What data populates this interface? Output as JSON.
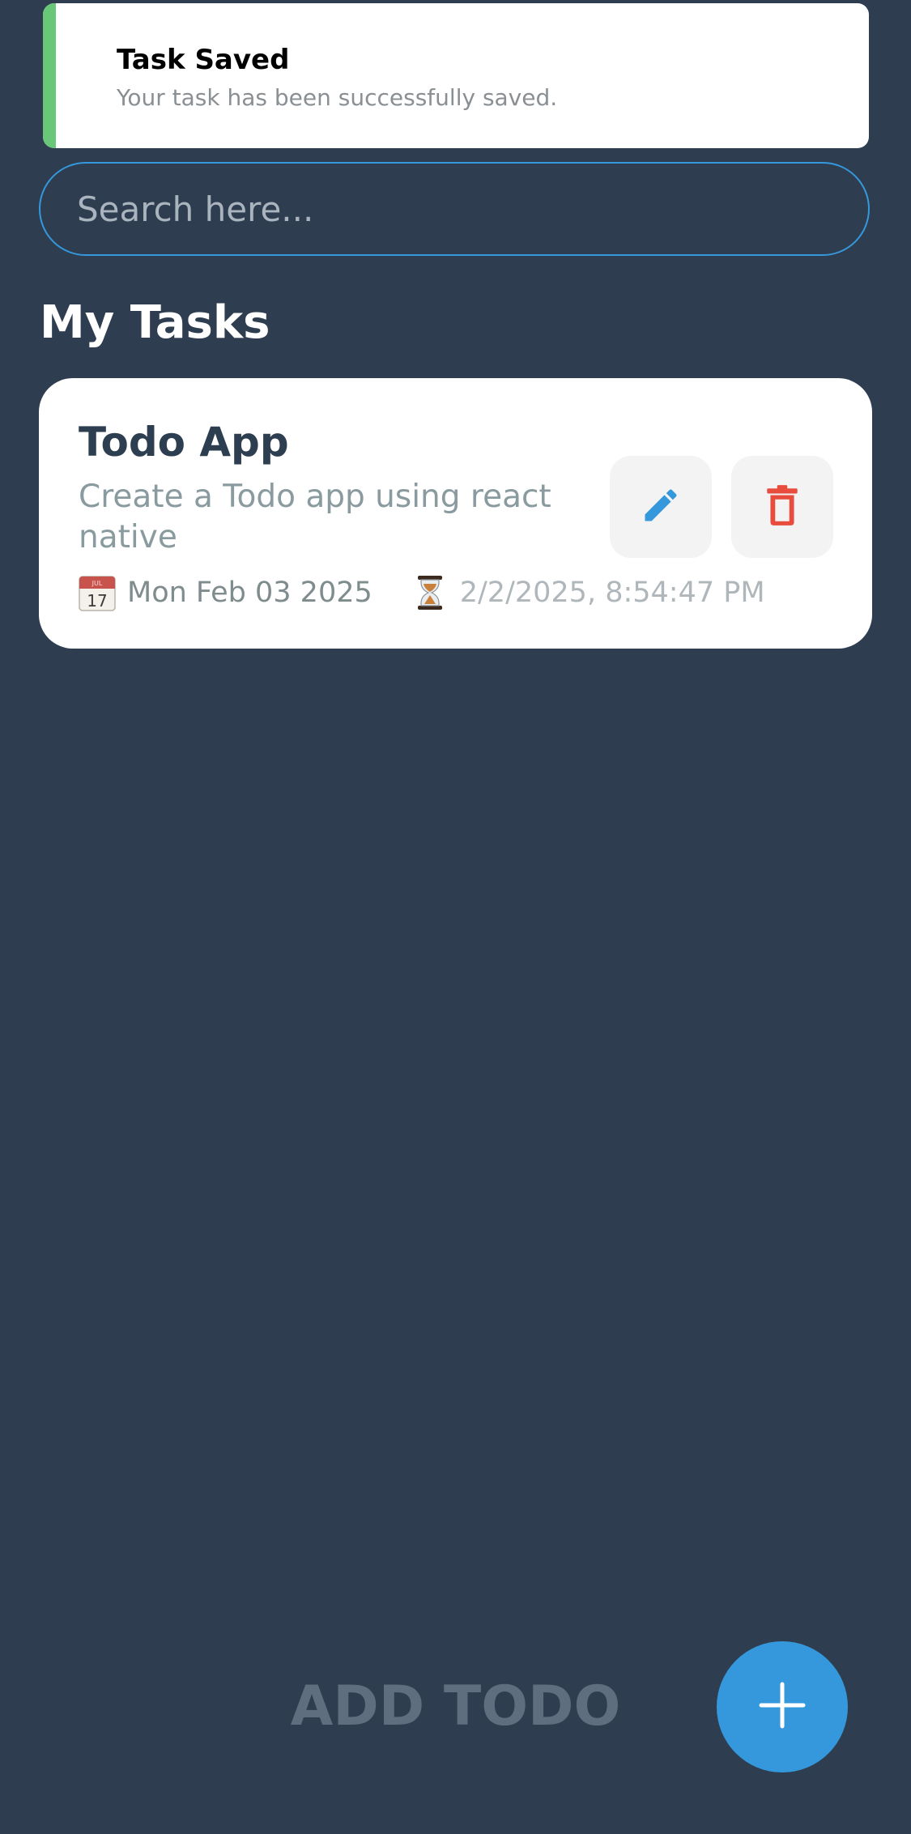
{
  "toast": {
    "title": "Task Saved",
    "message": "Your task has been successfully saved.",
    "accent_color": "#69c779"
  },
  "search": {
    "placeholder": "Search here...",
    "value": ""
  },
  "section": {
    "title": "My Tasks"
  },
  "tasks": [
    {
      "title": "Todo App",
      "description": "Create a Todo app using react native",
      "due_date": "Mon Feb 03 2025",
      "created_at": "2/2/2025, 8:54:47 PM",
      "due_icon": "calendar-icon",
      "created_icon": "hourglass-icon",
      "edit_icon": "pencil-icon",
      "delete_icon": "trash-icon"
    }
  ],
  "footer": {
    "add_label": "ADD TODO",
    "fab_icon": "plus-icon"
  },
  "colors": {
    "background": "#2e3e50",
    "accent": "#3598dc",
    "delete": "#e74c3c"
  }
}
